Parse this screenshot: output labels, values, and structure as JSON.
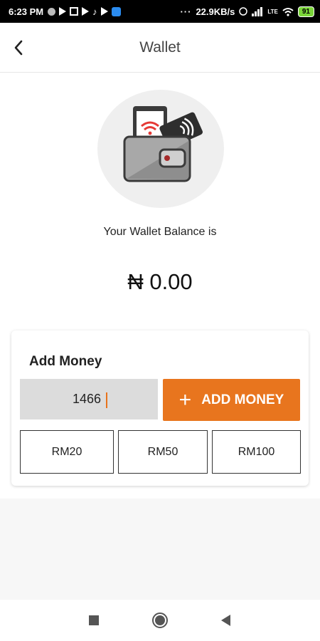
{
  "status_bar": {
    "time": "6:23 PM",
    "net_speed": "22.9KB/s",
    "network": "LTE",
    "battery": "91"
  },
  "header": {
    "title": "Wallet",
    "back_icon": "chevron-left-icon"
  },
  "wallet": {
    "illustration_icon": "wallet-contactless-icon",
    "balance_label": "Your Wallet Balance is",
    "balance_value": "₦ 0.00"
  },
  "add_money": {
    "heading": "Add Money",
    "amount_value": "1466",
    "button_label": "ADD MONEY",
    "button_icon": "plus-icon",
    "presets": [
      "RM20",
      "RM50",
      "RM100"
    ]
  },
  "colors": {
    "accent": "#e8751e",
    "input_bg": "#dcdcdc",
    "illustration_bg": "#efefef"
  },
  "nav": {
    "recent_icon": "square-icon",
    "home_icon": "circle-icon",
    "back_icon": "triangle-back-icon"
  }
}
